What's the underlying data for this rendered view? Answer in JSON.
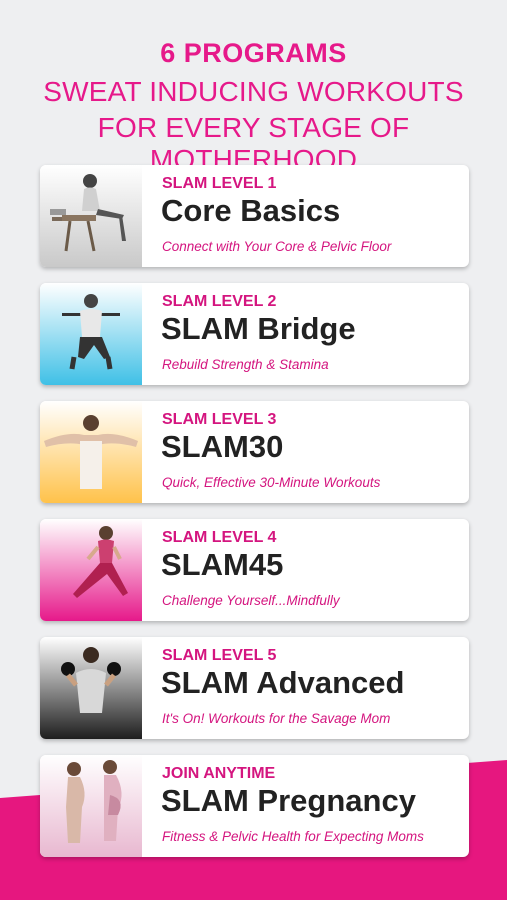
{
  "header": {
    "line1": "6 PROGRAMS",
    "line2": "SWEAT INDUCING WORKOUTS",
    "line3": "FOR EVERY STAGE OF MOTHERHOOD"
  },
  "colors": {
    "accent": "#e6198a",
    "title_text": "#222222",
    "background": "#eeeff1"
  },
  "programs": [
    {
      "level": "SLAM LEVEL 1",
      "title": "Core Basics",
      "tagline": "Connect with Your Core & Pelvic Floor",
      "thumb_color": "#9a9a9a"
    },
    {
      "level": "SLAM LEVEL 2",
      "title": "SLAM Bridge",
      "tagline": "Rebuild Strength & Stamina",
      "thumb_color": "#3fc0e6"
    },
    {
      "level": "SLAM LEVEL 3",
      "title": "SLAM30",
      "tagline": "Quick, Effective 30-Minute Workouts",
      "thumb_color": "#ffc24a"
    },
    {
      "level": "SLAM LEVEL 4",
      "title": "SLAM45",
      "tagline": "Challenge Yourself...Mindfully",
      "thumb_color": "#e6198a"
    },
    {
      "level": "SLAM LEVEL 5",
      "title": "SLAM Advanced",
      "tagline": "It's On! Workouts for the Savage Mom",
      "thumb_color": "#222222"
    },
    {
      "level": "JOIN ANYTIME",
      "title": "SLAM Pregnancy",
      "tagline": "Fitness & Pelvic Health for Expecting Moms",
      "thumb_color": "#e8c0d4"
    }
  ]
}
